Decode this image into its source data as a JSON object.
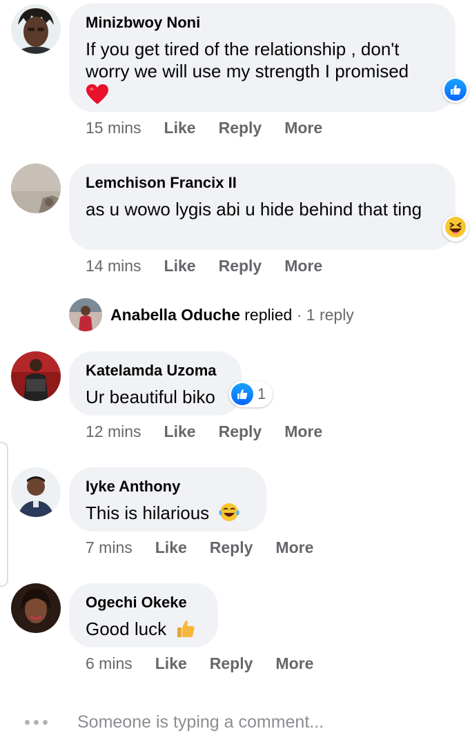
{
  "comments": [
    {
      "author": "Minizbwoy Noni",
      "text": "If you get tired of the relationship , don't worry we will use my strength I promised",
      "emoji": "❤️",
      "time": "15 mins",
      "reaction": "like-icon"
    },
    {
      "author": "Lemchison Francix II",
      "text": "as u wowo lygis abi u hide behind that ting",
      "time": "14 mins",
      "reaction": "laughing-squint-icon"
    },
    {
      "author": "Katelamda Uzoma",
      "text": "Ur beautiful biko",
      "time": "12 mins",
      "reaction": "like-icon",
      "reaction_count": "1"
    },
    {
      "author": "Iyke Anthony",
      "text": "This is hilarious",
      "emoji": "😂",
      "time": "7 mins"
    },
    {
      "author": "Ogechi Okeke",
      "text": "Good luck",
      "emoji": "👍",
      "time": "6 mins"
    }
  ],
  "actions": {
    "like": "Like",
    "reply": "Reply",
    "more": "More"
  },
  "reply_summary": {
    "author": "Anabella Oduche",
    "verb": "replied",
    "separator": "·",
    "count": "1 reply"
  },
  "typing": {
    "label": "Someone is typing a comment..."
  },
  "colors": {
    "bubble": "#f0f2f5",
    "meta_text": "#65676b",
    "like_blue": "#0866ff",
    "heart_red": "#f02849"
  }
}
